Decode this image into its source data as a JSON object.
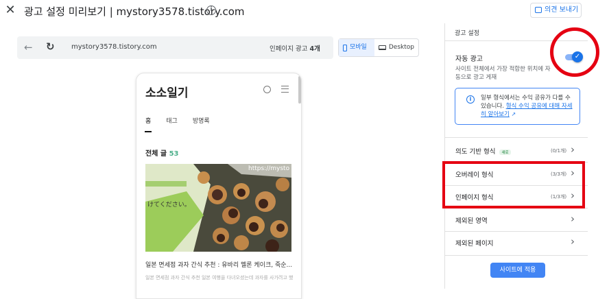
{
  "topbar": {
    "title": "광고 설정 미리보기 | mystory3578.tistory.com",
    "close_icon": "close-icon",
    "info_icon": "info-icon",
    "feedback_label": "의견 보내기"
  },
  "preview": {
    "url": "mystory3578.tistory.com",
    "interstitial_label": "인페이지 광고",
    "interstitial_count": "4개",
    "device_mobile": "모바일",
    "device_desktop": "Desktop"
  },
  "blog": {
    "title": "소소일기",
    "tabs": [
      "홈",
      "태그",
      "방명록"
    ],
    "total_label": "전체 글",
    "total_count": "53",
    "post_title": "일본 면세점 과자 간식 추천 : 유바리 멜론 케이크, 죽순...",
    "post_snippet": "일본 면세점 과자 간식 추천 일본 여행을 다녀오셨는데 과자를 사가려고 했던"
  },
  "panel": {
    "header": "광고 설정",
    "auto_label": "자동 광고",
    "auto_desc": "사이트 전체에서 가장 적합한 위치에 자동으로 광고 게재",
    "auto_enabled": true,
    "notice_text": "일부 형식에서는 수익 공유가 다를 수 있습니다.",
    "notice_link": "형식 수익 공유에 대해 자세히 알아보기",
    "rows": [
      {
        "label": "의도 기반 형식",
        "badge": "새로",
        "count": "(0/1개)"
      },
      {
        "label": "오버레이 형식",
        "count": "(3/3개)"
      },
      {
        "label": "인페이지 형식",
        "count": "(1/3개)"
      },
      {
        "label": "제외된 영역",
        "count": ""
      },
      {
        "label": "제외된 페이지",
        "count": ""
      }
    ],
    "apply_label": "사이트에 적용"
  },
  "colors": {
    "accent": "#1a73e8",
    "annotation": "#e50012"
  }
}
